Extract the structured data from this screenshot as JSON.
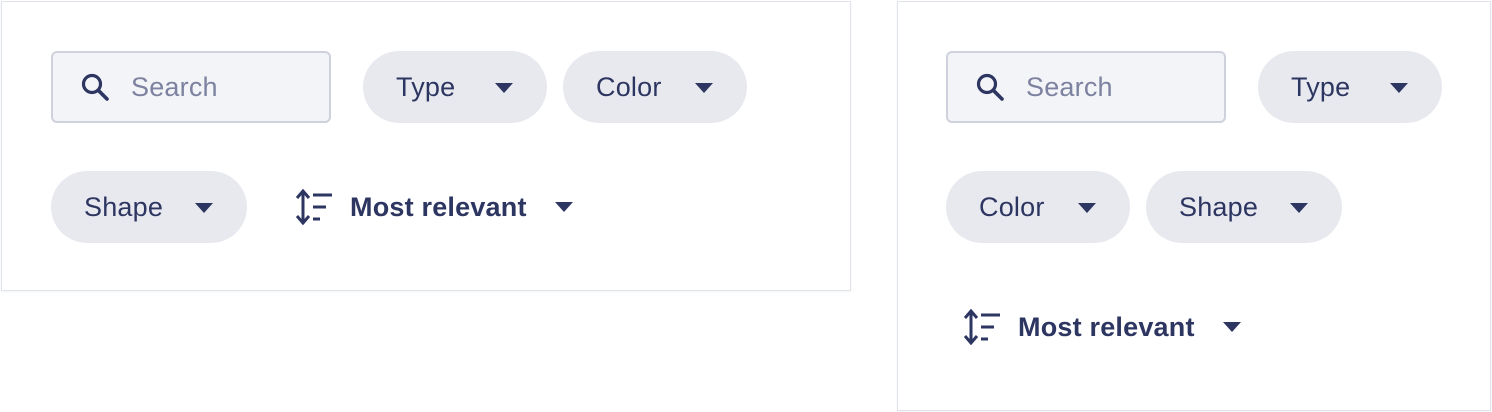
{
  "colors": {
    "text": "#2d3561",
    "placeholder": "#7c829f",
    "chip_bg": "#e8e9ef",
    "search_bg": "#f3f4f8",
    "search_border": "#cfd2dd"
  },
  "search": {
    "placeholder": "Search",
    "icon": "search-icon"
  },
  "filters": {
    "type_label": "Type",
    "color_label": "Color",
    "shape_label": "Shape",
    "caret_icon": "caret-down-icon"
  },
  "sort": {
    "label": "Most relevant",
    "icon": "sort-icon"
  }
}
